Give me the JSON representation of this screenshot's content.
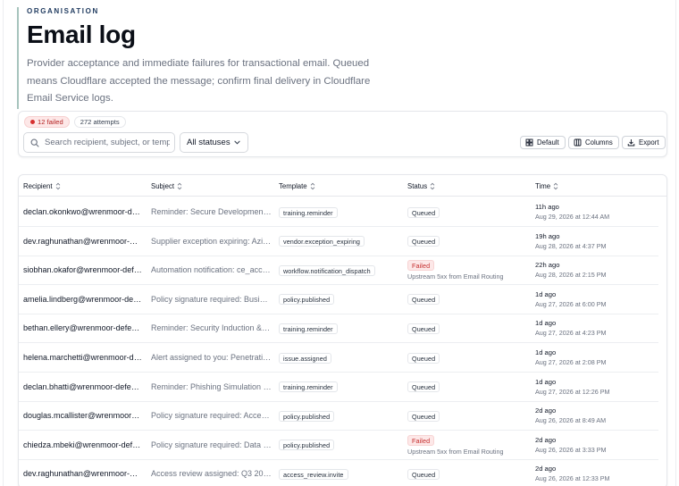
{
  "header": {
    "eyebrow": "ORGANISATION",
    "title": "Email log",
    "description": "Provider acceptance and immediate failures for transactional email. Queued means Cloudflare accepted the message; confirm final delivery in Cloudflare Email Service logs."
  },
  "toolbar": {
    "failed_badge": "12 failed",
    "attempts_badge": "272 attempts",
    "search_placeholder": "Search recipient, subject, or template",
    "status_filter": "All statuses",
    "default_label": "Default",
    "columns_label": "Columns",
    "export_label": "Export"
  },
  "table": {
    "columns": [
      "Recipient",
      "Subject",
      "Template",
      "Status",
      "Time"
    ],
    "rows": [
      {
        "recipient": "declan.okonkwo@wrenmoor-defence.example",
        "subject": "Reminder: Secure Development Training",
        "template": "training.reminder",
        "status": "Queued",
        "note": "",
        "rel": "11h ago",
        "abs": "Aug 29, 2026 at 12:44 AM"
      },
      {
        "recipient": "dev.raghunathan@wrenmoor-defence.example",
        "subject": "Supplier exception expiring: Azimuth",
        "template": "vendor.exception_expiring",
        "status": "Queued",
        "note": "",
        "rel": "19h ago",
        "abs": "Aug 28, 2026 at 4:37 PM"
      },
      {
        "recipient": "siobhan.okafor@wrenmoor-defence.example",
        "subject": "Automation notification: ce_access_review",
        "template": "workflow.notification_dispatch",
        "status": "Failed",
        "note": "Upstream 5xx from Email Routing",
        "rel": "22h ago",
        "abs": "Aug 28, 2026 at 2:15 PM"
      },
      {
        "recipient": "amelia.lindberg@wrenmoor-defence.example",
        "subject": "Policy signature required: Business Continuity",
        "template": "policy.published",
        "status": "Queued",
        "note": "",
        "rel": "1d ago",
        "abs": "Aug 27, 2026 at 6:00 PM"
      },
      {
        "recipient": "bethan.ellery@wrenmoor-defence.example",
        "subject": "Reminder: Security Induction & Awareness",
        "template": "training.reminder",
        "status": "Queued",
        "note": "",
        "rel": "1d ago",
        "abs": "Aug 27, 2026 at 4:23 PM"
      },
      {
        "recipient": "helena.marchetti@wrenmoor-defence.example",
        "subject": "Alert assigned to you: Penetration test",
        "template": "issue.assigned",
        "status": "Queued",
        "note": "",
        "rel": "1d ago",
        "abs": "Aug 27, 2026 at 2:08 PM"
      },
      {
        "recipient": "declan.bhatti@wrenmoor-defence.example",
        "subject": "Reminder: Phishing Simulation & Awareness",
        "template": "training.reminder",
        "status": "Queued",
        "note": "",
        "rel": "1d ago",
        "abs": "Aug 27, 2026 at 12:26 PM"
      },
      {
        "recipient": "douglas.mcallister@wrenmoor-defence.example",
        "subject": "Policy signature required: Access Control",
        "template": "policy.published",
        "status": "Queued",
        "note": "",
        "rel": "2d ago",
        "abs": "Aug 26, 2026 at 8:49 AM"
      },
      {
        "recipient": "chiedza.mbeki@wrenmoor-defence.example",
        "subject": "Policy signature required: Data Protection",
        "template": "policy.published",
        "status": "Failed",
        "note": "Upstream 5xx from Email Routing",
        "rel": "2d ago",
        "abs": "Aug 26, 2026 at 3:33 PM"
      },
      {
        "recipient": "dev.raghunathan@wrenmoor-defence.example",
        "subject": "Access review assigned: Q3 2026",
        "template": "access_review.invite",
        "status": "Queued",
        "note": "",
        "rel": "2d ago",
        "abs": "Aug 26, 2026 at 12:33 PM"
      }
    ]
  },
  "colors": {
    "accent_bar": "#a7c4bd",
    "failed_bg": "#fde8e8",
    "failed_text": "#c42b2b"
  },
  "icons": [
    "search-icon",
    "chevron-down-icon",
    "sort-icon",
    "grid-icon",
    "columns-icon",
    "export-icon"
  ]
}
